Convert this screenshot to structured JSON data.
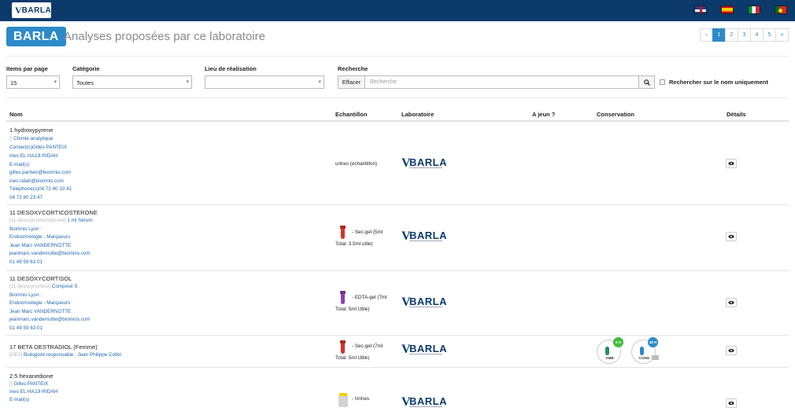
{
  "header": {
    "logo_text": "BARLA",
    "languages": [
      "English",
      "Español",
      "Italiano",
      "Português"
    ]
  },
  "title_row": {
    "badge": "BARLA",
    "title": "Analyses proposées par ce laboratoire"
  },
  "pagination": {
    "items": [
      "«",
      "1",
      "2",
      "3",
      "4",
      "5",
      "»"
    ],
    "active": "1"
  },
  "filters": {
    "items_per_page_label": "Items par page",
    "items_per_page_value": "15",
    "categorie_label": "Catégorie",
    "categorie_value": "Toutes",
    "lieu_label": "Lieu de réalisation",
    "lieu_value": "",
    "recherche_label": "Recherche",
    "effacer_label": "Effacer",
    "search_placeholder": "Recherche",
    "name_only_label": "Rechercher sur le nom uniquement"
  },
  "table": {
    "columns": [
      "Nom",
      "Echantillon",
      "Laboratoire",
      "A jeun ?",
      "Conservation",
      "Détails"
    ],
    "rows": [
      {
        "name": "1 hydroxypyrene",
        "lines": [
          {
            "muted": "[] ",
            "text": "Chimie analytique"
          },
          {
            "muted": "",
            "text": "Contact(s)Gilles PANTEIX"
          },
          {
            "muted": "",
            "text": "Ines EL HAJJI-RIDAH"
          },
          {
            "muted": "",
            "text": "E-mail(s)"
          },
          {
            "muted": "",
            "text": "gilles.panteix@biomnis.com"
          },
          {
            "muted": "",
            "text": "ines.ridah@biomnis.com"
          },
          {
            "muted": "",
            "text": "Téléphone(s)04 72 80 10 41"
          },
          {
            "muted": "",
            "text": "04 72 80 23 47"
          }
        ],
        "echantillon": [
          "urines (echantillon)"
        ],
        "laboratoire": "BARLA",
        "a_jeun": "",
        "conservation": []
      },
      {
        "name": "11 DESOXYCORTICOSTERONE",
        "lines": [
          {
            "muted": "[11-désoxycorticostérone] ",
            "text": "1 ml Sérum"
          },
          {
            "muted": "",
            "text": "Biomnis Lyon :"
          },
          {
            "muted": "",
            "text": "Endocrinologie - Marqueurs"
          },
          {
            "muted": "",
            "text": "Jean Marc VANDERNOTTE"
          },
          {
            "muted": "",
            "text": "jeanmarc.vandernotte@biomnis.com"
          },
          {
            "muted": "",
            "text": "01 49 59 63 01"
          }
        ],
        "echantillon": [
          "- Sec-gel (5ml",
          "Total: 3.5ml utile)"
        ],
        "laboratoire": "BARLA",
        "a_jeun": "",
        "conservation": []
      },
      {
        "name": "11 DESOXYCORTISOL",
        "lines": [
          {
            "muted": "[11-désoxycortisol] ",
            "text": "Composé S"
          },
          {
            "muted": "",
            "text": "Biomnis Lyon :"
          },
          {
            "muted": "",
            "text": "Endocrinologie - Marqueurs"
          },
          {
            "muted": "",
            "text": "Jean Marc VANDERNOTTE"
          },
          {
            "muted": "",
            "text": "jeanmarc.vandernotte@biomnis.com"
          },
          {
            "muted": "",
            "text": "01 49 59 63 01"
          }
        ],
        "echantillon": [
          "- EDTA-gel (7ml",
          "Total: 5ml Utile)"
        ],
        "laboratoire": "BARLA",
        "a_jeun": "",
        "conservation": []
      },
      {
        "name": "17 BETA OESTRADIOL (Femme)",
        "lines": [
          {
            "muted": "[OE2] ",
            "text": "Biologiste responsable : Jean Philippe Collot"
          }
        ],
        "echantillon": [
          "- Sec-gel (7ml",
          "Total: 5ml Utile)"
        ],
        "laboratoire": "BARLA",
        "a_jeun": "",
        "conservation": [
          {
            "label": "AMB",
            "badge": "8 H",
            "color": "#3fbf3f"
          },
          {
            "label": "CONG",
            "badge": "48 H",
            "color": "#2d8ac9"
          }
        ]
      },
      {
        "name": "2.5 hexanedione",
        "lines": [
          {
            "muted": "[] ",
            "text": "Gilles PANTEIX"
          },
          {
            "muted": "",
            "text": "Ines EL HAJJI-RIDAH"
          },
          {
            "muted": "",
            "text": "E-mail(s)"
          }
        ],
        "echantillon": [
          "- Urines"
        ],
        "laboratoire": "BARLA",
        "a_jeun": "",
        "conservation": []
      }
    ]
  },
  "colors": {
    "header_bg": "#0b3a6b",
    "accent": "#2d8ac9",
    "link": "#1f66b0",
    "tube_red": "#d9302c",
    "tube_purple": "#8a3fb5"
  }
}
